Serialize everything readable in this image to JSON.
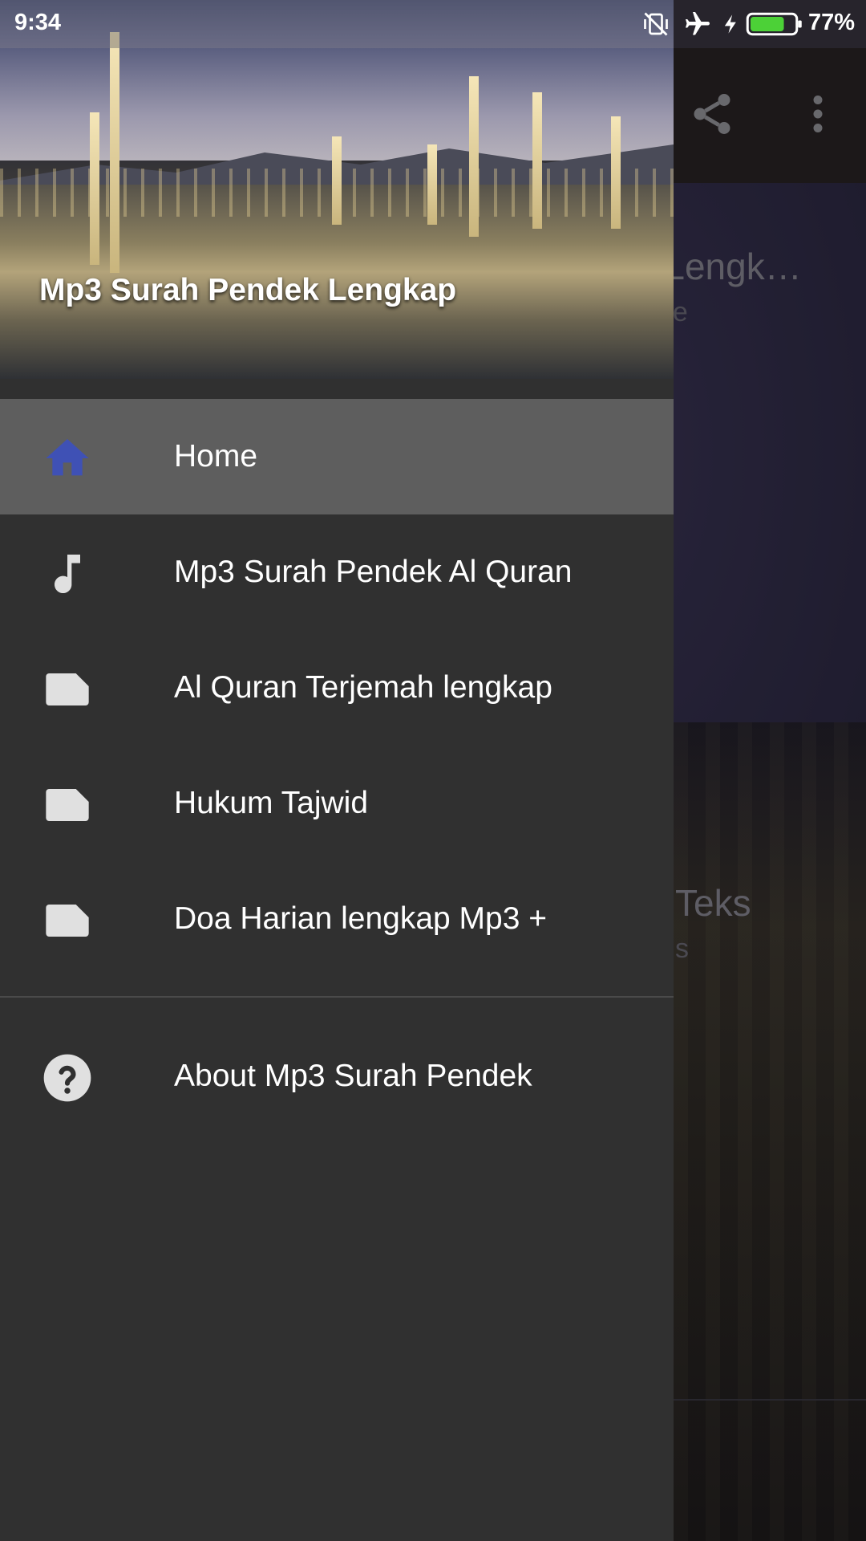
{
  "status_bar": {
    "time": "9:34",
    "battery_percent": "77%",
    "battery_level": 0.77,
    "icons": [
      "vibrate-off-icon",
      "airplane-icon",
      "charging-bolt-icon",
      "battery-icon"
    ]
  },
  "drawer": {
    "header_title": "Mp3 Surah Pendek Lengkap",
    "items": [
      {
        "label": "Home",
        "icon": "home-icon",
        "active": true
      },
      {
        "label": "Mp3 Surah Pendek Al Quran",
        "icon": "music-note-icon",
        "active": false
      },
      {
        "label": "Al Quran Terjemah lengkap",
        "icon": "document-icon",
        "active": false
      },
      {
        "label": "Hukum Tajwid",
        "icon": "document-icon",
        "active": false
      },
      {
        "label": "Doa Harian lengkap Mp3 +",
        "icon": "document-icon",
        "active": false
      }
    ],
    "about": {
      "label": "About Mp3 Surah Pendek",
      "icon": "help-circle-icon"
    }
  },
  "background_app": {
    "toolbar_icons": [
      "share-icon",
      "more-vert-icon"
    ],
    "card1_title": "n Lengk…",
    "card1_sub": "ne",
    "card2_title": "Teks",
    "card2_sub": "s"
  },
  "colors": {
    "drawer_bg": "#303030",
    "active_item_bg": "#5e5e5e",
    "home_icon": "#3f51b5",
    "icon_grey": "#e0e0e0",
    "battery_green": "#4cd137"
  }
}
